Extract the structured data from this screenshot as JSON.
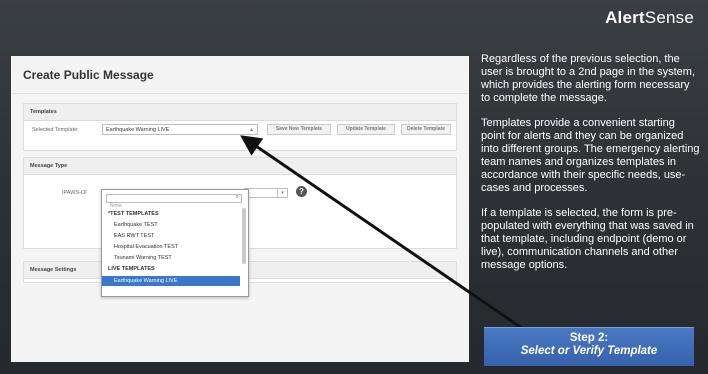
{
  "brand": {
    "bold": "Alert",
    "regular": "Sense"
  },
  "screenshot": {
    "page_title": "Create Public Message",
    "templates_panel": {
      "heading": "Templates",
      "selected_label": "Selected Template:",
      "selected_value": "Earthquake Warning LIVE",
      "buttons": {
        "save": "Save New Template",
        "update": "Update Template",
        "delete": "Delete Template"
      }
    },
    "message_type_panel": {
      "heading": "Message Type",
      "field_label": "IPAWS-OI"
    },
    "message_settings_panel": {
      "heading": "Message Settings"
    },
    "dropdown": {
      "clipped_item": "None",
      "groups": [
        {
          "label": "*TEST TEMPLATES",
          "items": [
            "Earthquake TEST",
            "EAS RWT TEST",
            "Hospital Evacuation TEST",
            "Tsunami Warning TEST"
          ]
        },
        {
          "label": "LIVE TEMPLATES",
          "items": [
            "Earthquake Warning LIVE"
          ]
        }
      ],
      "active_item": "Earthquake Warning LIVE"
    }
  },
  "description": [
    "Regardless of the previous selection, the user is brought to a 2nd page in the system, which provides the alerting form necessary to complete the message.",
    "Templates provide a convenient starting point for alerts and they can be organized into different groups. The emergency alerting team names and organizes templates in accordance with their specific needs, use-cases and processes.",
    "If a template is selected, the form is pre-populated with everything that was saved in that template, including endpoint (demo or live), communication channels and other message options."
  ],
  "step_callout": {
    "line1": "Step 2:",
    "line2": "Select or Verify Template"
  },
  "colors": {
    "callout": "#3a68b2",
    "dropdown_highlight": "#3a78c9",
    "background": "#2f3338"
  }
}
